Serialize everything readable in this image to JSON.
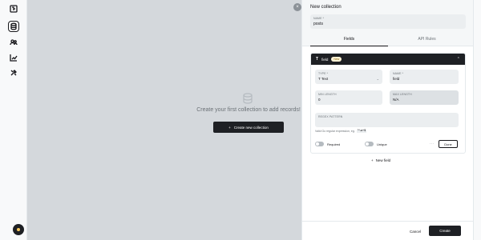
{
  "main": {
    "empty_text": "Create your first collection to add records!",
    "create_button": "Create new collection",
    "create_button_icon": "+"
  },
  "panel": {
    "title": "New collection",
    "name_field": {
      "label": "NAME *",
      "value": "posts"
    },
    "tabs": [
      {
        "label": "Fields",
        "active": true
      },
      {
        "label": "API Rules",
        "active": false
      }
    ],
    "field": {
      "type_icon": "T",
      "name": "field",
      "badge": "New",
      "type": {
        "label": "TYPE *",
        "icon": "T",
        "value": "Text"
      },
      "field_name": {
        "label": "NAME *",
        "value": "field"
      },
      "min_length": {
        "label": "MIN LENGTH",
        "value": "0"
      },
      "max_length": {
        "label": "MAX LENGTH",
        "value": "N/A"
      },
      "regex": {
        "label": "REGEX PATTERN",
        "value": ""
      },
      "regex_help": "Valid Go regular expression, eg.",
      "regex_example": "^\\w+$",
      "required_label": "Required",
      "unique_label": "Unique",
      "more": "···",
      "done": "Done"
    },
    "new_field": "New field",
    "new_field_icon": "+",
    "cancel": "Cancel",
    "create": "Create"
  },
  "avatar_color": "#f7c85e",
  "accent": "#1e2024"
}
